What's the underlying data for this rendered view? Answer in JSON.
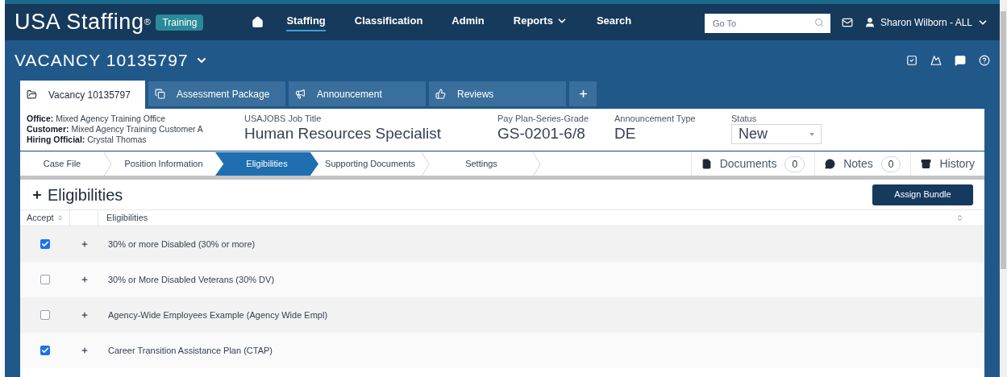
{
  "header": {
    "logo": "USA Staffing",
    "logo_mark": "®",
    "badge": "Training",
    "nav": [
      {
        "label": "Staffing",
        "selected": true,
        "kind": "link"
      },
      {
        "label": "Classification",
        "selected": false,
        "kind": "link"
      },
      {
        "label": "Admin",
        "selected": false,
        "kind": "link"
      },
      {
        "label": "Reports",
        "selected": false,
        "kind": "dropdown"
      },
      {
        "label": "Search",
        "selected": false,
        "kind": "link"
      }
    ],
    "search": {
      "placeholder": "Go To"
    },
    "user": "Sharon Wilborn - ALL"
  },
  "vacancy_title": "VACANCY 10135797",
  "tabs": [
    {
      "label": "Vacancy 10135797",
      "selected": true
    },
    {
      "label": "Assessment Package",
      "selected": false
    },
    {
      "label": "Announcement",
      "selected": false
    },
    {
      "label": "Reviews",
      "selected": false
    }
  ],
  "info": {
    "lines": [
      {
        "label": "Office:",
        "value": "Mixed Agency Training Office"
      },
      {
        "label": "Customer:",
        "value": "Mixed Agency Training Customer A"
      },
      {
        "label": "Hiring Official:",
        "value": "Crystal Thomas"
      }
    ],
    "fields": [
      {
        "label": "USAJOBS Job Title",
        "value": "Human Resources Specialist"
      },
      {
        "label": "Pay Plan-Series-Grade",
        "value": "GS-0201-6/8"
      },
      {
        "label": "Announcement Type",
        "value": "DE"
      }
    ],
    "status": {
      "label": "Status",
      "value": "New"
    }
  },
  "steps": [
    {
      "label": "Case File",
      "selected": false
    },
    {
      "label": "Position Information",
      "selected": false
    },
    {
      "label": "Eligibilities",
      "selected": true
    },
    {
      "label": "Supporting Documents",
      "selected": false
    },
    {
      "label": "Settings",
      "selected": false
    }
  ],
  "side_links": [
    {
      "label": "Documents",
      "count": "0"
    },
    {
      "label": "Notes",
      "count": "0"
    },
    {
      "label": "History"
    }
  ],
  "section": {
    "title": "Eligibilities",
    "button": "Assign Bundle"
  },
  "table": {
    "columns": [
      "Accept",
      "Eligibilities"
    ],
    "rows": [
      {
        "checked": true,
        "name": "30% or more Disabled (30% or more)"
      },
      {
        "checked": false,
        "name": "30% or More Disabled Veterans (30% DV)"
      },
      {
        "checked": false,
        "name": "Agency-Wide Employees Example (Agency Wide Empl)"
      },
      {
        "checked": true,
        "name": "Career Transition Assistance Plan (CTAP)"
      }
    ]
  }
}
